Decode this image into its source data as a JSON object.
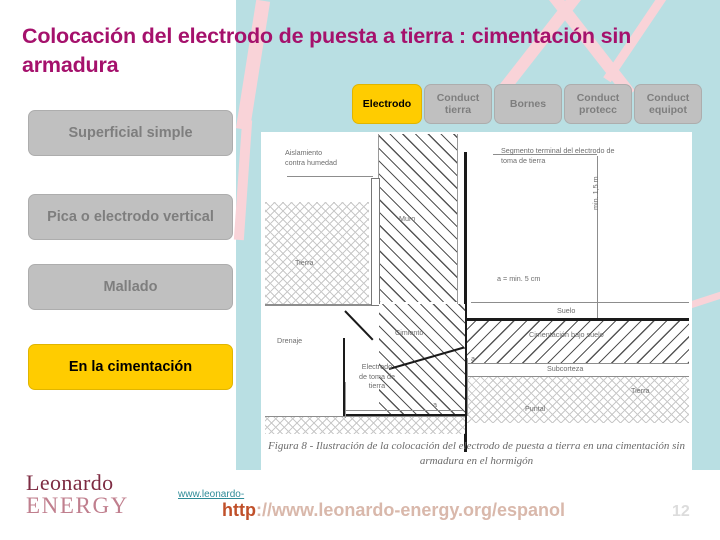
{
  "slide": {
    "title": "Colocación del electrodo de puesta a tierra : cimentación sin armadura",
    "title_color": "#a5116c",
    "background_color": "#b9dfe3"
  },
  "nav_top": {
    "items": [
      {
        "label": "Electrodo",
        "active": true,
        "color": "#ffcc00"
      },
      {
        "label": "Conduct tierra",
        "active": false,
        "color": "#c0c0c0"
      },
      {
        "label": "Bornes",
        "active": false,
        "color": "#c0c0c0"
      },
      {
        "label": "Conduct protecc",
        "active": false,
        "color": "#c0c0c0"
      },
      {
        "label": "Conduct equipot",
        "active": false,
        "color": "#c0c0c0"
      }
    ]
  },
  "nav_left": {
    "items": [
      {
        "label": "Superficial simple",
        "active": false,
        "color": "#c0c0c0"
      },
      {
        "label": "Pica o electrodo vertical",
        "active": false,
        "color": "#c0c0c0"
      },
      {
        "label": "Mallado",
        "active": false,
        "color": "#c0c0c0"
      },
      {
        "label": "En la cimentación",
        "active": true,
        "color": "#ffcc00"
      }
    ]
  },
  "diagram": {
    "caption": "Figura 8 - Ilustración de la colocación del electrodo de puesta a tierra en una cimentación sin armadura en el hormigón",
    "labels": {
      "aislamiento": "Aislamiento\ncontra humedad",
      "muro": "Muro",
      "tierra_left": "Tierra",
      "min_altura": "min. 1,5 m",
      "segmento": "Segmento terminal del electrodo de\ntoma de tierra",
      "a_min": "a = min. 5 cm",
      "drenaje": "Drenaje",
      "cimiento": "Cimiento",
      "electrodo": "Electrodo\nde toma de\ntierra",
      "a_bottom": "a",
      "a_right": "a",
      "suelo": "Suelo",
      "cimentacion_bajo": "Cimentación bajo suelo",
      "subcorteza": "Subcorteza",
      "tierra_right": "Tierra",
      "puntal": "Puntal"
    }
  },
  "footer": {
    "logo_top": "Leonardo",
    "logo_bottom": "ENERGY",
    "url_small": "www.leonardo-",
    "url_prefix": "http",
    "url_rest": "://www.leonardo-energy.org/espanol",
    "page_number": "12"
  }
}
